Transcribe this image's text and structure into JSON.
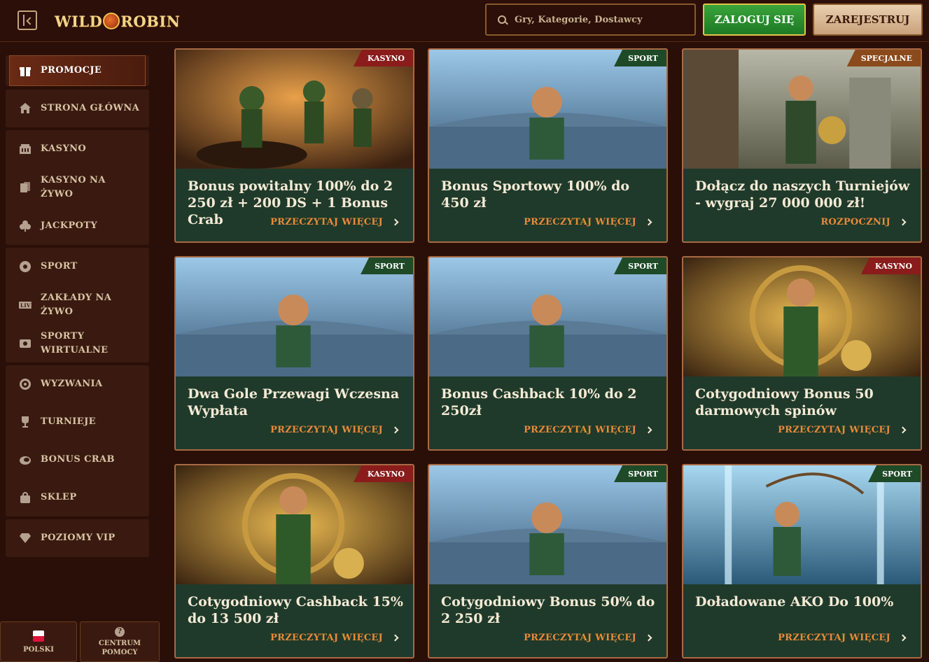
{
  "header": {
    "logo": "WILD ROBIN",
    "search_placeholder": "Gry, Kategorie, Dostawcy",
    "login_label": "ZALOGUJ SIĘ",
    "register_label": "ZAREJESTRUJ"
  },
  "sidebar": {
    "groups": [
      [
        {
          "label": "PROMOCJE",
          "icon": "gift-icon",
          "active": true
        }
      ],
      [
        {
          "label": "STRONA GŁÓWNA",
          "icon": "home-icon"
        }
      ],
      [
        {
          "label": "KASYNO",
          "icon": "casino-icon"
        },
        {
          "label": "KASYNO NA ŻYWO",
          "icon": "live-cards-icon"
        },
        {
          "label": "JACKPOTY",
          "icon": "clover-icon"
        }
      ],
      [
        {
          "label": "SPORT",
          "icon": "ball-icon"
        },
        {
          "label": "ZAKŁADY NA ŻYWO",
          "icon": "live-icon"
        },
        {
          "label": "SPORTY WIRTUALNE",
          "icon": "virtual-icon"
        }
      ],
      [
        {
          "label": "WYZWANIA",
          "icon": "target-icon"
        },
        {
          "label": "TURNIEJE",
          "icon": "trophy-icon"
        },
        {
          "label": "BONUS CRAB",
          "icon": "crab-icon"
        },
        {
          "label": "SKLEP",
          "icon": "bag-icon"
        }
      ],
      [
        {
          "label": "POZIOMY VIP",
          "icon": "diamond-icon"
        }
      ]
    ],
    "language_label": "POLSKI",
    "help_label": "CENTRUM POMOCY"
  },
  "cards": [
    {
      "badge": "KASYNO",
      "badge_type": "kasyno",
      "title": "Bonus powitalny 100% do 2 250 zł + 200 DS + 1 Bonus Crab",
      "link": "PRZECZYTAJ WIĘCEJ",
      "scene": "warm"
    },
    {
      "badge": "SPORT",
      "badge_type": "sport",
      "title": "Bonus Sportowy 100% do 450 zł",
      "link": "PRZECZYTAJ WIĘCEJ",
      "scene": "blue"
    },
    {
      "badge": "SPECJALNE",
      "badge_type": "specjalne",
      "title": "Dołącz do naszych Turniejów - wygraj 27 000 000 zł!",
      "link": "ROZPOCZNIJ",
      "scene": "grey"
    },
    {
      "badge": "SPORT",
      "badge_type": "sport",
      "title": "Dwa Gole Przewagi Wczesna Wypłata",
      "link": "PRZECZYTAJ WIĘCEJ",
      "scene": "blue"
    },
    {
      "badge": "SPORT",
      "badge_type": "sport",
      "title": "Bonus Cashback 10% do 2 250zł",
      "link": "PRZECZYTAJ WIĘCEJ",
      "scene": "blue"
    },
    {
      "badge": "KASYNO",
      "badge_type": "kasyno",
      "title": "Cotygodniowy Bonus 50 darmowych spinów",
      "link": "PRZECZYTAJ WIĘCEJ",
      "scene": "gold"
    },
    {
      "badge": "KASYNO",
      "badge_type": "kasyno",
      "title": "Cotygodniowy Cashback 15% do 13 500 zł",
      "link": "PRZECZYTAJ WIĘCEJ",
      "scene": "gold"
    },
    {
      "badge": "SPORT",
      "badge_type": "sport",
      "title": "Cotygodniowy Bonus 50% do 2 250 zł",
      "link": "PRZECZYTAJ WIĘCEJ",
      "scene": "blue"
    },
    {
      "badge": "SPORT",
      "badge_type": "sport",
      "title": "Doładowane AKO Do 100%",
      "link": "PRZECZYTAJ WIĘCEJ",
      "scene": "cyan"
    }
  ]
}
